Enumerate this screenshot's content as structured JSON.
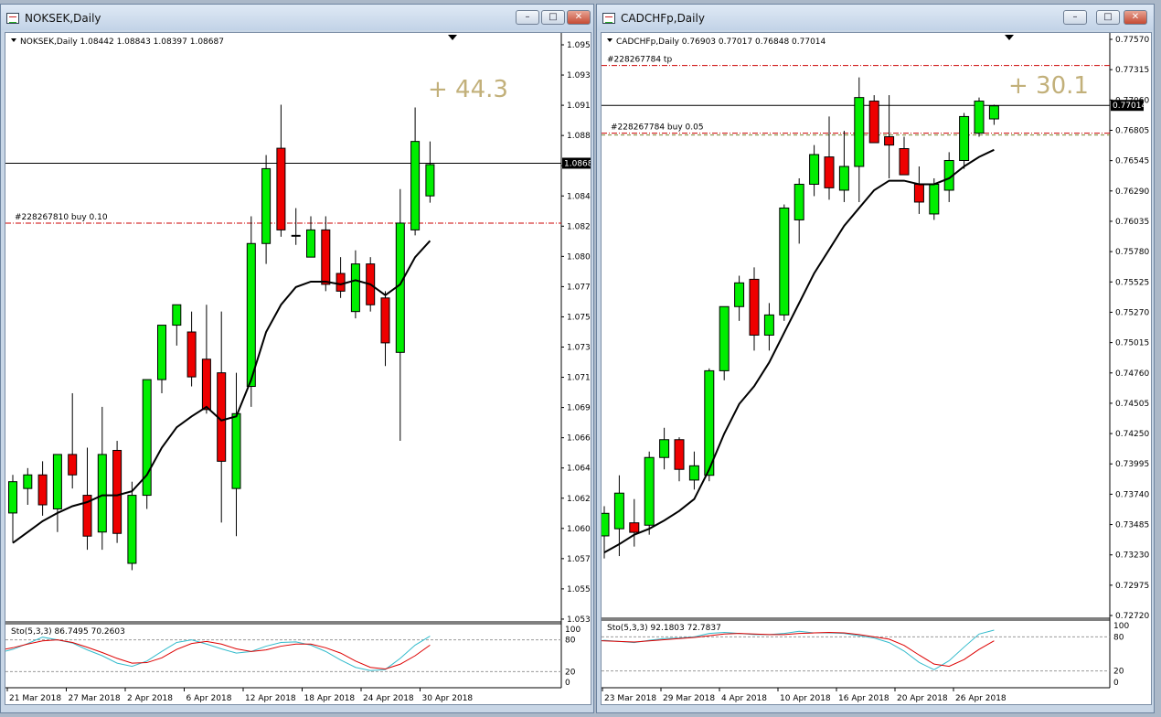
{
  "windows": [
    {
      "key": "nok",
      "title": "NOKSEK,Daily",
      "header": "NOKSEK,Daily  1.08442 1.08843 1.08397 1.08687",
      "profit": "+ 44.3",
      "price_tag": "1.0868",
      "order_line": "#228267810 buy 0.10",
      "stoch_header": "Sto(5,3,3) 86.7495 70.2603",
      "stoch_levels": [
        "100",
        "80",
        "20",
        "0"
      ],
      "price_axis": [
        "1.0956",
        "1.0934",
        "1.0912",
        "1.0889",
        "1.0867",
        "1.0845",
        "1.0823",
        "1.0801",
        "1.0778",
        "1.0756",
        "1.0734",
        "1.0712",
        "1.0690",
        "1.0667",
        "1.0645",
        "1.0623",
        "1.0601",
        "1.0579",
        "1.0557",
        "1.0534"
      ],
      "date_axis": [
        "21 Mar 2018",
        "27 Mar 2018",
        "2 Apr 2018",
        "6 Apr 2018",
        "12 Apr 2018",
        "18 Apr 2018",
        "24 Apr 2018",
        "30 Apr 2018"
      ]
    },
    {
      "key": "cad",
      "title": "CADCHFp,Daily",
      "header": "CADCHFp,Daily  0.76903 0.77017 0.76848 0.77014",
      "profit": "+ 30.1",
      "price_tag": "0.77014",
      "tp_line": "#228267784 tp",
      "order_line": "#228267784 buy  0.05",
      "stoch_header": "Sto(5,3,3) 92.1803 72.7837",
      "stoch_levels": [
        "100",
        "80",
        "20",
        "0"
      ],
      "price_axis": [
        "0.77570",
        "0.77315",
        "0.77060",
        "0.76805",
        "0.76545",
        "0.76290",
        "0.76035",
        "0.75780",
        "0.75525",
        "0.75270",
        "0.75015",
        "0.74760",
        "0.74505",
        "0.74250",
        "0.73995",
        "0.73740",
        "0.73485",
        "0.73230",
        "0.72975",
        "0.72720"
      ],
      "date_axis": [
        "23 Mar 2018",
        "29 Mar 2018",
        "4 Apr 2018",
        "10 Apr 2018",
        "16 Apr 2018",
        "20 Apr 2018",
        "26 Apr 2018"
      ]
    }
  ],
  "chart_data": [
    {
      "type": "candlestick",
      "title": "NOKSEK,Daily",
      "ylim": [
        1.0534,
        1.0956
      ],
      "candles": [
        {
          "o": 1.0612,
          "h": 1.064,
          "l": 1.059,
          "c": 1.0635
        },
        {
          "o": 1.063,
          "h": 1.0645,
          "l": 1.0618,
          "c": 1.064
        },
        {
          "o": 1.064,
          "h": 1.065,
          "l": 1.061,
          "c": 1.0618
        },
        {
          "o": 1.0615,
          "h": 1.0655,
          "l": 1.0598,
          "c": 1.0655
        },
        {
          "o": 1.0655,
          "h": 1.07,
          "l": 1.063,
          "c": 1.064
        },
        {
          "o": 1.0625,
          "h": 1.066,
          "l": 1.0585,
          "c": 1.0595
        },
        {
          "o": 1.0598,
          "h": 1.069,
          "l": 1.0585,
          "c": 1.0655
        },
        {
          "o": 1.0658,
          "h": 1.0665,
          "l": 1.059,
          "c": 1.0597
        },
        {
          "o": 1.0575,
          "h": 1.0635,
          "l": 1.057,
          "c": 1.0625
        },
        {
          "o": 1.0625,
          "h": 1.0705,
          "l": 1.0615,
          "c": 1.071
        },
        {
          "o": 1.071,
          "h": 1.0745,
          "l": 1.07,
          "c": 1.075
        },
        {
          "o": 1.075,
          "h": 1.0755,
          "l": 1.0735,
          "c": 1.0765
        },
        {
          "o": 1.0745,
          "h": 1.076,
          "l": 1.0705,
          "c": 1.0712
        },
        {
          "o": 1.0725,
          "h": 1.0765,
          "l": 1.0685,
          "c": 1.0688
        },
        {
          "o": 1.0715,
          "h": 1.076,
          "l": 1.0605,
          "c": 1.065
        },
        {
          "o": 1.063,
          "h": 1.0715,
          "l": 1.0595,
          "c": 1.0685
        },
        {
          "o": 1.0705,
          "h": 1.083,
          "l": 1.069,
          "c": 1.081
        },
        {
          "o": 1.081,
          "h": 1.0875,
          "l": 1.0795,
          "c": 1.0865
        },
        {
          "o": 1.088,
          "h": 1.0912,
          "l": 1.0815,
          "c": 1.082
        },
        {
          "o": 1.0816,
          "h": 1.0836,
          "l": 1.0809,
          "c": 1.0816
        },
        {
          "o": 1.08,
          "h": 1.083,
          "l": 1.08,
          "c": 1.082
        },
        {
          "o": 1.082,
          "h": 1.083,
          "l": 1.0775,
          "c": 1.078
        },
        {
          "o": 1.0788,
          "h": 1.08,
          "l": 1.077,
          "c": 1.0775
        },
        {
          "o": 1.076,
          "h": 1.0805,
          "l": 1.0755,
          "c": 1.0795
        },
        {
          "o": 1.0795,
          "h": 1.08,
          "l": 1.076,
          "c": 1.0765
        },
        {
          "o": 1.077,
          "h": 1.0775,
          "l": 1.072,
          "c": 1.0737
        },
        {
          "o": 1.073,
          "h": 1.085,
          "l": 1.0665,
          "c": 1.0825
        },
        {
          "o": 1.082,
          "h": 1.091,
          "l": 1.0816,
          "c": 1.0885
        },
        {
          "o": 1.0845,
          "h": 1.0885,
          "l": 1.084,
          "c": 1.0868
        }
      ],
      "ma": [
        1.059,
        1.0598,
        1.0606,
        1.0612,
        1.0617,
        1.062,
        1.0625,
        1.0625,
        1.0628,
        1.064,
        1.066,
        1.0675,
        1.0683,
        1.069,
        1.068,
        1.0683,
        1.071,
        1.0745,
        1.0765,
        1.0778,
        1.0782,
        1.0782,
        1.078,
        1.0783,
        1.078,
        1.0772,
        1.078,
        1.08,
        1.0812
      ],
      "stoch_main": [
        55,
        62,
        73,
        85,
        80,
        74,
        61,
        50,
        36,
        30,
        40,
        58,
        75,
        80,
        72,
        63,
        55,
        58,
        68,
        75,
        76,
        70,
        58,
        42,
        28,
        22,
        24,
        45,
        70,
        87
      ],
      "stoch_signal": [
        60,
        65,
        72,
        78,
        80,
        75,
        66,
        56,
        45,
        36,
        37,
        46,
        62,
        73,
        77,
        72,
        63,
        58,
        61,
        68,
        72,
        72,
        65,
        55,
        40,
        28,
        25,
        34,
        50,
        70
      ],
      "order_price": 1.0825,
      "current_price": 1.0869
    },
    {
      "type": "candlestick",
      "title": "CADCHFp,Daily",
      "ylim": [
        0.7272,
        0.7757
      ],
      "candles": [
        {
          "o": 0.7339,
          "h": 0.7364,
          "l": 0.732,
          "c": 0.7358
        },
        {
          "o": 0.7345,
          "h": 0.739,
          "l": 0.7322,
          "c": 0.7375
        },
        {
          "o": 0.735,
          "h": 0.737,
          "l": 0.733,
          "c": 0.7342
        },
        {
          "o": 0.7348,
          "h": 0.741,
          "l": 0.734,
          "c": 0.7405
        },
        {
          "o": 0.7405,
          "h": 0.743,
          "l": 0.7395,
          "c": 0.742
        },
        {
          "o": 0.742,
          "h": 0.7422,
          "l": 0.7385,
          "c": 0.7395
        },
        {
          "o": 0.7386,
          "h": 0.741,
          "l": 0.7378,
          "c": 0.7398
        },
        {
          "o": 0.739,
          "h": 0.748,
          "l": 0.7385,
          "c": 0.7478
        },
        {
          "o": 0.7478,
          "h": 0.7532,
          "l": 0.747,
          "c": 0.7532
        },
        {
          "o": 0.7532,
          "h": 0.7558,
          "l": 0.752,
          "c": 0.7552
        },
        {
          "o": 0.7555,
          "h": 0.7565,
          "l": 0.7495,
          "c": 0.7508
        },
        {
          "o": 0.7508,
          "h": 0.7535,
          "l": 0.7495,
          "c": 0.7525
        },
        {
          "o": 0.7525,
          "h": 0.7618,
          "l": 0.752,
          "c": 0.7615
        },
        {
          "o": 0.7605,
          "h": 0.764,
          "l": 0.7585,
          "c": 0.7635
        },
        {
          "o": 0.7635,
          "h": 0.7668,
          "l": 0.7625,
          "c": 0.766
        },
        {
          "o": 0.7658,
          "h": 0.7692,
          "l": 0.7622,
          "c": 0.7632
        },
        {
          "o": 0.763,
          "h": 0.768,
          "l": 0.762,
          "c": 0.765
        },
        {
          "o": 0.765,
          "h": 0.7725,
          "l": 0.762,
          "c": 0.7708
        },
        {
          "o": 0.7705,
          "h": 0.771,
          "l": 0.767,
          "c": 0.767
        },
        {
          "o": 0.7675,
          "h": 0.771,
          "l": 0.764,
          "c": 0.7668
        },
        {
          "o": 0.7665,
          "h": 0.7675,
          "l": 0.7645,
          "c": 0.7643
        },
        {
          "o": 0.7635,
          "h": 0.765,
          "l": 0.761,
          "c": 0.762
        },
        {
          "o": 0.761,
          "h": 0.764,
          "l": 0.7605,
          "c": 0.7635
        },
        {
          "o": 0.763,
          "h": 0.7662,
          "l": 0.762,
          "c": 0.7655
        },
        {
          "o": 0.7655,
          "h": 0.7695,
          "l": 0.7648,
          "c": 0.7692
        },
        {
          "o": 0.7678,
          "h": 0.7708,
          "l": 0.7675,
          "c": 0.7705
        },
        {
          "o": 0.769,
          "h": 0.7702,
          "l": 0.7685,
          "c": 0.7701
        }
      ],
      "ma": [
        0.7325,
        0.7332,
        0.734,
        0.7345,
        0.7352,
        0.736,
        0.737,
        0.7395,
        0.7425,
        0.745,
        0.7465,
        0.7485,
        0.751,
        0.7535,
        0.756,
        0.758,
        0.76,
        0.7615,
        0.763,
        0.7638,
        0.7638,
        0.7635,
        0.7635,
        0.764,
        0.765,
        0.7658,
        0.7664
      ],
      "stoch_main": [
        70,
        74,
        72,
        70,
        74,
        77,
        78,
        80,
        86,
        88,
        86,
        84,
        84,
        86,
        90,
        87,
        87,
        86,
        82,
        78,
        70,
        55,
        35,
        22,
        38,
        62,
        85,
        92
      ],
      "stoch_signal": [
        74,
        73,
        72,
        71,
        73,
        75,
        77,
        79,
        82,
        85,
        86,
        85,
        84,
        84,
        86,
        87,
        88,
        87,
        84,
        80,
        76,
        65,
        48,
        32,
        28,
        40,
        58,
        73
      ],
      "tp_price": 0.7735,
      "order_price": 0.7678,
      "current_price": 0.77014
    }
  ],
  "colors": {
    "bull": "#00ee00",
    "bear": "#ee0000",
    "stoch_main": "#33bbcc",
    "stoch_signal": "#dd0000",
    "order_line": "#cc0000",
    "profit_text": "#c2b07a"
  }
}
